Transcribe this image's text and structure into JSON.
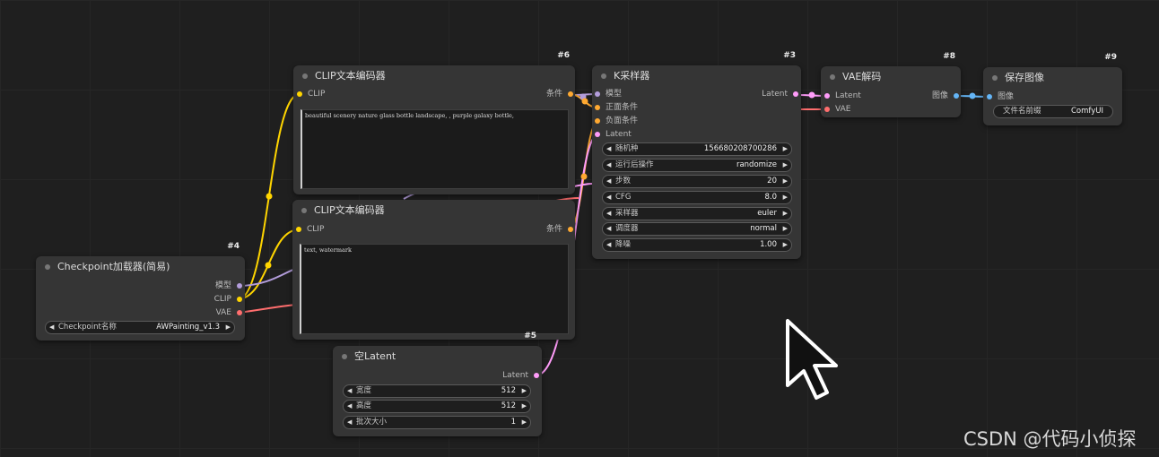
{
  "colors": {
    "clip": "#ffd500",
    "model": "#b39ddb",
    "vae": "#ff6e6e",
    "latent": "#ff9cf9",
    "conditioning": "#ffa931",
    "image": "#64b5f6"
  },
  "nodes": {
    "clip_pos": {
      "id": "#6",
      "title": "CLIP文本编码器",
      "in_clip": "CLIP",
      "out_cond": "条件",
      "text": "beautiful scenery nature glass bottle landscape, , purple galaxy bottle,"
    },
    "clip_neg": {
      "id": "",
      "title": "CLIP文本编码器",
      "in_clip": "CLIP",
      "out_cond": "条件",
      "text": "text, watermark"
    },
    "checkpoint": {
      "id": "#4",
      "title": "Checkpoint加载器(简易)",
      "out_model": "模型",
      "out_clip": "CLIP",
      "out_vae": "VAE",
      "w_label": "Checkpoint名称",
      "w_value": "AWPainting_v1.3"
    },
    "ksampler": {
      "id": "#3",
      "title": "K采样器",
      "in_model": "模型",
      "in_pos": "正面条件",
      "in_neg": "负面条件",
      "in_latent": "Latent",
      "out_latent": "Latent",
      "widgets": [
        {
          "label": "随机种",
          "value": "156680208700286"
        },
        {
          "label": "运行后操作",
          "value": "randomize"
        },
        {
          "label": "步数",
          "value": "20"
        },
        {
          "label": "CFG",
          "value": "8.0"
        },
        {
          "label": "采样器",
          "value": "euler"
        },
        {
          "label": "调度器",
          "value": "normal"
        },
        {
          "label": "降噪",
          "value": "1.00"
        }
      ]
    },
    "empty_latent": {
      "id": "#5",
      "title": "空Latent",
      "out_latent": "Latent",
      "widgets": [
        {
          "label": "宽度",
          "value": "512"
        },
        {
          "label": "高度",
          "value": "512"
        },
        {
          "label": "批次大小",
          "value": "1"
        }
      ]
    },
    "vae_decode": {
      "id": "#8",
      "title": "VAE解码",
      "in_latent": "Latent",
      "in_vae": "VAE",
      "out_image": "图像"
    },
    "save_image": {
      "id": "#9",
      "title": "保存图像",
      "in_image": "图像",
      "w_label": "文件名前缀",
      "w_value": "ComfyUI"
    }
  },
  "watermark": "CSDN @代码小侦探"
}
